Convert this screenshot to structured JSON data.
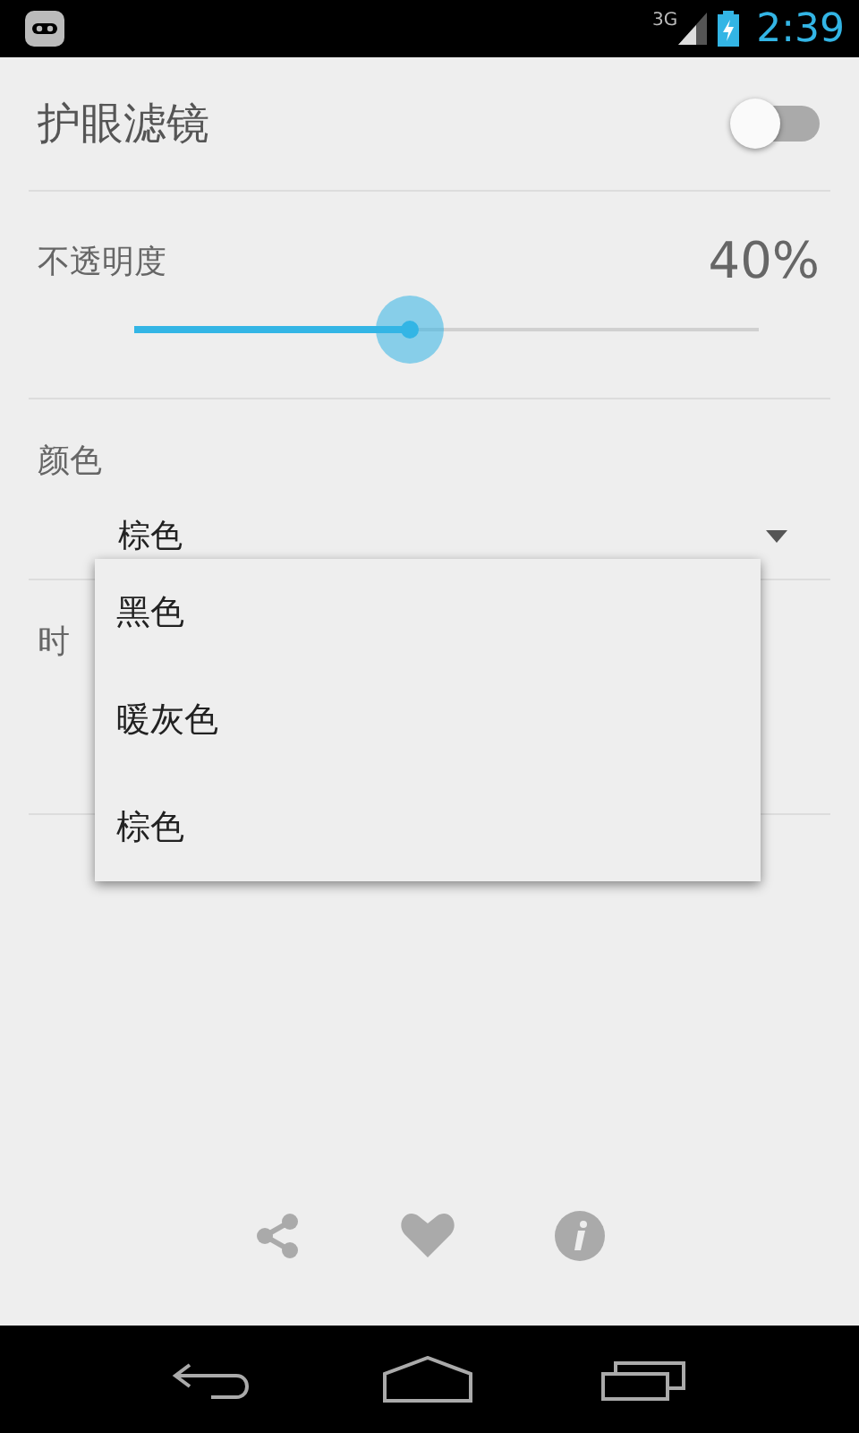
{
  "status_bar": {
    "network": "3G",
    "time": "2:39"
  },
  "filter": {
    "title": "护眼滤镜",
    "on": false
  },
  "opacity": {
    "label": "不透明度",
    "reading": "40%",
    "level": 0.44
  },
  "color": {
    "label": "颜色",
    "value": "棕色"
  },
  "time": {
    "label": "时"
  },
  "color_menu": {
    "items": [
      {
        "label": "黑色"
      },
      {
        "label": "暖灰色"
      },
      {
        "label": "棕色"
      }
    ]
  }
}
